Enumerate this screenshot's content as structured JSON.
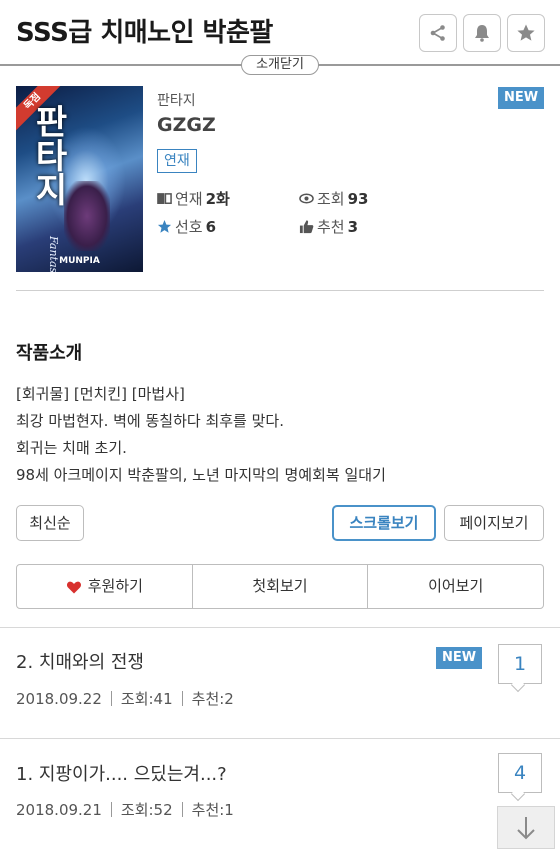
{
  "header": {
    "title": "SSS급 치매노인 박춘팔",
    "share_icon": "share-icon",
    "bell_icon": "bell-icon",
    "star_icon": "star-icon",
    "intro_toggle": "소개닫기"
  },
  "work": {
    "cover": {
      "ribbon": "독점",
      "title": "판타지",
      "subtitle": "Fantasy",
      "publisher": "MUNPIA"
    },
    "genre": "판타지",
    "author": "GZGZ",
    "new_badge": "NEW",
    "status": "연재",
    "stats": {
      "episodes_label": "연재",
      "episodes_value": "2화",
      "views_label": "조회",
      "views_value": "93",
      "favorites_label": "선호",
      "favorites_value": "6",
      "recommends_label": "추천",
      "recommends_value": "3"
    }
  },
  "intro": {
    "title": "작품소개",
    "lines": [
      "[회귀물] [먼치킨] [마법사]",
      "최강 마법현자. 벽에 똥칠하다 최후를 맞다.",
      "회귀는 치매 초기.",
      "98세 아크메이지 박춘팔의, 노년 마지막의 명예회복 일대기"
    ]
  },
  "controls": {
    "sort_latest": "최신순",
    "scroll_view": "스크롤보기",
    "page_view": "페이지보기"
  },
  "actions": {
    "support": "후원하기",
    "first": "첫회보기",
    "continue": "이어보기"
  },
  "episodes": [
    {
      "title": "2. 치매와의 전쟁",
      "badge": "NEW",
      "date": "2018.09.22",
      "views": "조회:41",
      "recommends": "추천:2",
      "comments": "1"
    },
    {
      "title": "1. 지팡이가.... 으딨는겨...?",
      "badge": "",
      "date": "2018.09.21",
      "views": "조회:52",
      "recommends": "추천:1",
      "comments": "4"
    }
  ],
  "colors": {
    "accent": "#4a92c9",
    "heart": "#d8312e",
    "ribbon": "#d23b2f"
  }
}
